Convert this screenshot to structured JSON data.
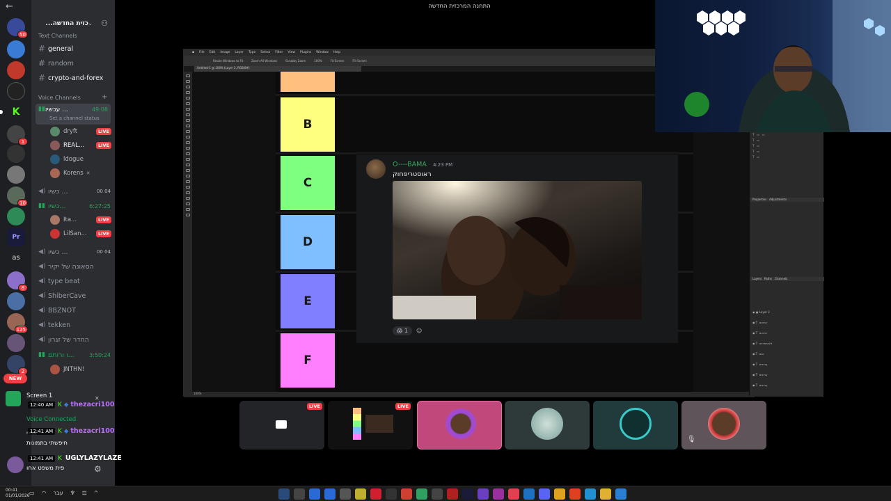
{
  "window_title": "התחנה המרכזית החדשה",
  "server": {
    "name": "...כזית החדשה"
  },
  "categories": {
    "text": "Text Channels",
    "voice": "Voice Channels"
  },
  "text_channels": [
    "general",
    "random",
    "crypto-and-forex"
  ],
  "active_voice": {
    "name": "עכשיו ...",
    "time": "49:08",
    "status": "Set a channel status"
  },
  "voice_users_1": [
    {
      "name": "dryft",
      "live": "LIVE"
    },
    {
      "name": "REAL...",
      "live": "LIVE"
    },
    {
      "name": "ldogue",
      "live": ""
    },
    {
      "name": "Korens",
      "live": ""
    }
  ],
  "voice_channels": [
    {
      "name": "כשיו ...",
      "extra": "00 04"
    },
    {
      "name": "כשיו...",
      "extra": "6:27:25"
    },
    {
      "name": "כשיו ...",
      "extra": "00 04"
    },
    {
      "name": "הסאונה של יקיר",
      "extra": ""
    },
    {
      "name": "type beat",
      "extra": ""
    },
    {
      "name": "ShiberCave",
      "extra": ""
    },
    {
      "name": "BBZNOT",
      "extra": ""
    },
    {
      "name": "tekken",
      "extra": ""
    },
    {
      "name": "החדר של זגרון",
      "extra": ""
    },
    {
      "name": "ו ורותם...",
      "extra": "3:50:24"
    }
  ],
  "voice_users_2": [
    {
      "name": "Ita...",
      "live": "LIVE"
    },
    {
      "name": "LilSan...",
      "live": "LIVE"
    }
  ],
  "voice_user_3": "JNTHN!",
  "server_badges": {
    "top": "50",
    "b1": "1",
    "b2": "10",
    "b3": "8",
    "b4": "125",
    "b5": "2",
    "new": "NEW",
    "as": "as"
  },
  "bottom": {
    "screen": "Screen 1",
    "voice_connected": "Voice Connected",
    "user_short": "אחיי",
    "user_line2": "חיפשתי בתמונות",
    "user_line3": "פית משפט אחו",
    "chat": [
      {
        "time": "12:40 AM",
        "user": "thezacri100"
      },
      {
        "time": "12:41 AM",
        "user": "thezacri100"
      },
      {
        "time": "12:41 AM",
        "user": "UGLYLAZYLAZE"
      }
    ]
  },
  "tiers": [
    "B",
    "C",
    "D",
    "E",
    "F"
  ],
  "message": {
    "author": "O----BAMA",
    "time": "4:23 PM",
    "text": "ראוסטריפחוק",
    "reaction_count": "1"
  },
  "tiles_live": "LIVE",
  "taskbar": {
    "time": "00:41",
    "date": "01/01/2026",
    "lang": "עבר"
  },
  "colors": {
    "discord_bg": "#2b2d31",
    "live_red": "#f23f43",
    "online_green": "#23a55a",
    "tier_orange": "#ffbf7f",
    "tier_b": "#ffff7f",
    "tier_c": "#7fff7f",
    "tier_d": "#7fbfff",
    "tier_e": "#7f7fff",
    "tier_f": "#ff7fff"
  },
  "icons": [
    "arrow-left-icon",
    "add-user-icon",
    "hash-icon",
    "speaker-icon",
    "settings-icon",
    "screen-share-icon",
    "mic-icon",
    "emoji-icon"
  ]
}
